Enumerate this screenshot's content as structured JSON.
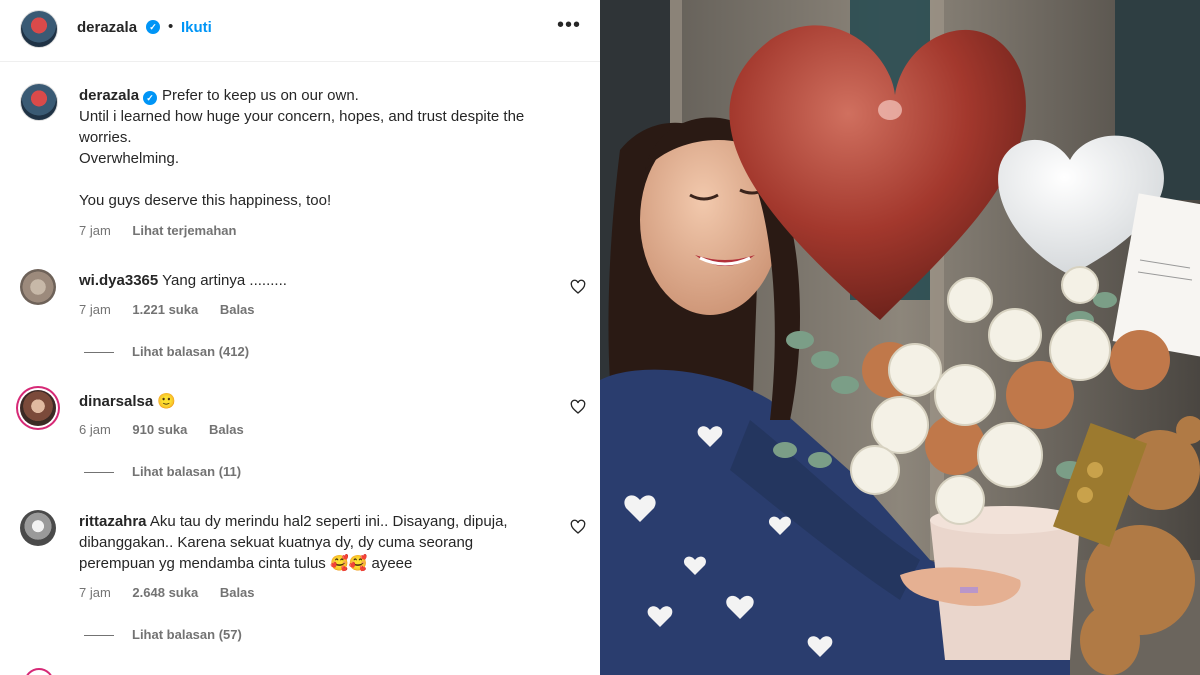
{
  "post": {
    "author": "derazala",
    "follow_label": "Ikuti",
    "separator": "•",
    "more_icon": "more-horizontal-icon"
  },
  "caption": {
    "username": "derazala",
    "text": "Prefer to keep us on our own.\nUntil i learned how huge your concern, hopes, and trust despite the worries.\nOverwhelming.\n\nYou guys deserve this happiness, too!",
    "time": "7 jam",
    "translate_label": "Lihat terjemahan"
  },
  "comments": [
    {
      "username": "wi.dya3365",
      "text": "Yang artinya .........",
      "time": "7 jam",
      "likes": "1.221 suka",
      "reply_label": "Balas",
      "view_replies": "Lihat balasan (412)"
    },
    {
      "username": "dinarsalsa",
      "text": "🙂",
      "time": "6 jam",
      "likes": "910 suka",
      "reply_label": "Balas",
      "view_replies": "Lihat balasan (11)"
    },
    {
      "username": "rittazahra",
      "text": "Aku tau dy merindu hal2 seperti ini.. Disayang, dipuja, dibanggakan.. Karena sekuat kuatnya dy, dy cuma seorang perempuan yg mendamba cinta tulus 🥰🥰 ayeee",
      "time": "7 jam",
      "likes": "2.648 suka",
      "reply_label": "Balas",
      "view_replies": "Lihat balasan (57)"
    }
  ],
  "colors": {
    "link_blue": "#0095f6",
    "text": "#262626",
    "secondary": "#737373",
    "balloon_red": "#a3382d"
  }
}
